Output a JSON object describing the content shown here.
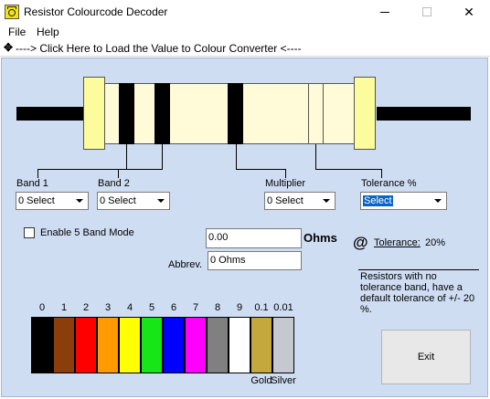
{
  "window": {
    "title": "Resistor Colourcode Decoder",
    "close_glyph": "✕"
  },
  "menu": {
    "file": "File",
    "help": "Help"
  },
  "load_bar": {
    "icon": "plus-icon",
    "text": "----> Click Here to Load the Value to Colour Converter <----"
  },
  "bands": {
    "band1": {
      "label": "Band 1",
      "value": "0 Select"
    },
    "band2": {
      "label": "Band 2",
      "value": "0 Select"
    },
    "multiplier": {
      "label": "Multiplier",
      "value": "0 Select"
    },
    "tolerance": {
      "label": "Tolerance %",
      "value": "Select"
    }
  },
  "five_band": {
    "label": "Enable 5 Band Mode",
    "checked": false
  },
  "result": {
    "value": "0.00",
    "unit": "Ohms",
    "abbrev_label": "Abbrev.",
    "abbrev_value": "0 Ohms"
  },
  "tolerance_display": {
    "label": "Tolerance:",
    "value": "20%"
  },
  "note": "Resistors with no tolerance band, have a default tolerance of +/- 20 %.",
  "color_chart": [
    {
      "digit": "0",
      "color": "#000000",
      "name": ""
    },
    {
      "digit": "1",
      "color": "#8b3d0b",
      "name": ""
    },
    {
      "digit": "2",
      "color": "#ff0000",
      "name": ""
    },
    {
      "digit": "3",
      "color": "#ff9a00",
      "name": ""
    },
    {
      "digit": "4",
      "color": "#ffff00",
      "name": ""
    },
    {
      "digit": "5",
      "color": "#17e517",
      "name": ""
    },
    {
      "digit": "6",
      "color": "#0000ff",
      "name": ""
    },
    {
      "digit": "7",
      "color": "#ff00ff",
      "name": ""
    },
    {
      "digit": "8",
      "color": "#808080",
      "name": ""
    },
    {
      "digit": "9",
      "color": "#ffffff",
      "name": ""
    },
    {
      "digit": "0.1",
      "color": "#c4a83e",
      "name": "Gold"
    },
    {
      "digit": "0.01",
      "color": "#c5c9cf",
      "name": "Silver"
    }
  ],
  "exit_label": "Exit"
}
